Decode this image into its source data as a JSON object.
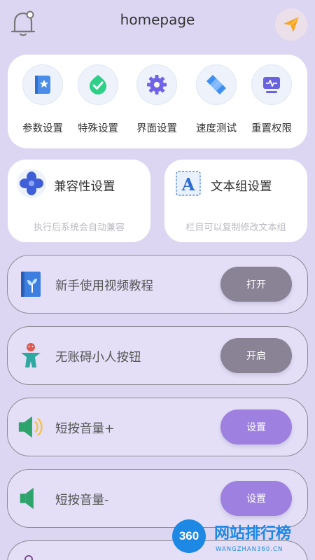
{
  "header": {
    "title": "homepage",
    "left_icon": "bell-icon",
    "right_icon": "send-icon"
  },
  "grid": [
    {
      "label": "参数设置",
      "icon": "settings-book-icon"
    },
    {
      "label": "特殊设置",
      "icon": "shield-check-icon"
    },
    {
      "label": "界面设置",
      "icon": "gear-icon"
    },
    {
      "label": "速度测试",
      "icon": "speed-diamond-icon"
    },
    {
      "label": "重置权限",
      "icon": "monitor-icon"
    }
  ],
  "cards": [
    {
      "title": "兼容性设置",
      "desc": "执行后系统会自动兼容",
      "icon": "compat-petal-icon"
    },
    {
      "title": "文本组设置",
      "desc": "栏目可以复制修改文本组",
      "icon": "letter-a-icon"
    }
  ],
  "rows": [
    {
      "label": "新手使用视频教程",
      "button": "打开",
      "icon": "book-plant-icon",
      "button_style": "gray"
    },
    {
      "label": "无账碍小人按钮",
      "button": "开启",
      "icon": "person-icon",
      "button_style": "gray"
    },
    {
      "label": "短按音量+",
      "button": "设置",
      "icon": "volume-up-icon",
      "button_style": "purple"
    },
    {
      "label": "短按音量-",
      "button": "设置",
      "icon": "volume-down-icon",
      "button_style": "purple"
    }
  ],
  "watermark": {
    "badge": "360",
    "text": "网站排行榜",
    "sub": "WANGZHAN360.CN"
  },
  "colors": {
    "background": "#dcd6f2",
    "button_gray": "#8a8395",
    "button_purple": "#9d80e0",
    "accent_orange": "#f5a623"
  }
}
